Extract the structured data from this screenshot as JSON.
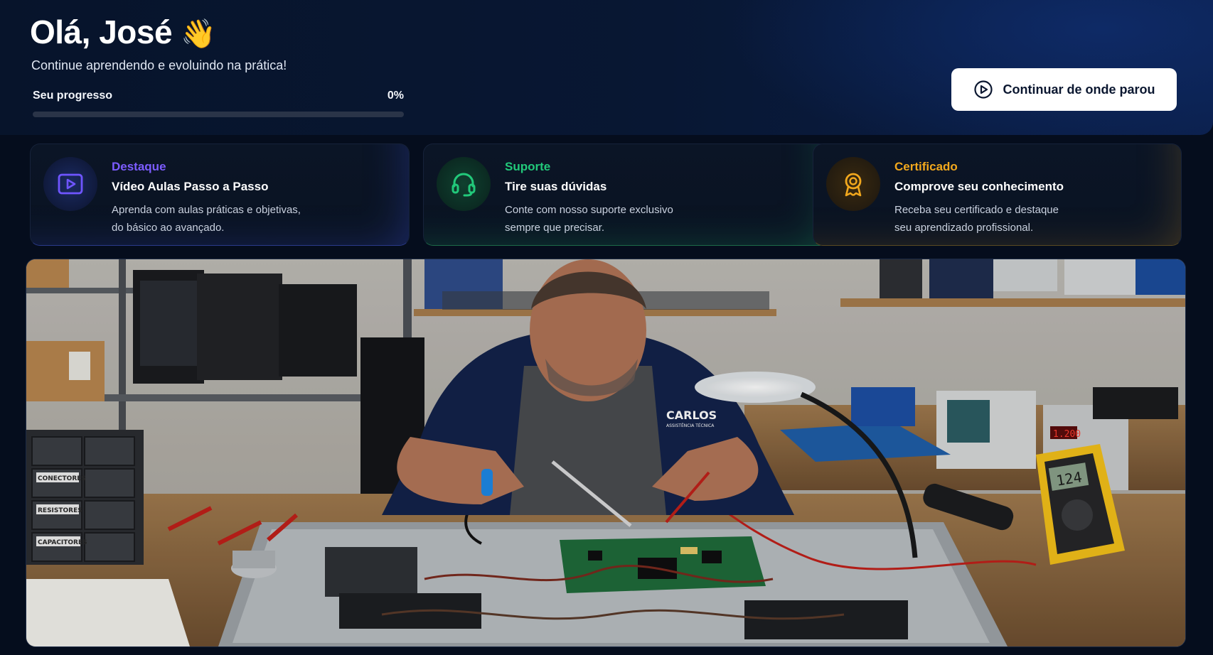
{
  "header": {
    "greeting": "Olá, José",
    "greeting_emoji": "👋",
    "subtitle": "Continue aprendendo e evoluindo na prática!",
    "progress_label": "Seu progresso",
    "progress_value_text": "0%",
    "progress_value": 0,
    "continue_button_label": "Continuar de onde parou",
    "continue_button_icon": "play-circle-icon"
  },
  "features": [
    {
      "eyebrow": "Destaque",
      "title": "Vídeo Aulas Passo a Passo",
      "desc_line1": "Aprenda com aulas práticas e objetivas,",
      "desc_line2": "do básico ao avançado.",
      "icon": "video-play-icon",
      "accent": "#7c5cff"
    },
    {
      "eyebrow": "Suporte",
      "title": "Tire suas dúvidas",
      "desc_line1": "Conte com nosso suporte exclusivo",
      "desc_line2": "sempre que precisar.",
      "icon": "headset-icon",
      "accent": "#22c97a"
    },
    {
      "eyebrow": "Certificado",
      "title": "Comprove seu conhecimento",
      "desc_line1": "Receba seu certificado e destaque",
      "desc_line2": "seu aprendizado profissional.",
      "icon": "award-icon",
      "accent": "#f2a81d"
    }
  ],
  "banner": {
    "shirt_text": "CARLOS",
    "shirt_subtext": "ASSISTÊNCIA TÉCNICA",
    "multimeter_reading": "124",
    "bench_display": "1.200",
    "bin_labels": [
      "CONECTORES",
      "RESISTORES",
      "CAPACITORES"
    ]
  }
}
